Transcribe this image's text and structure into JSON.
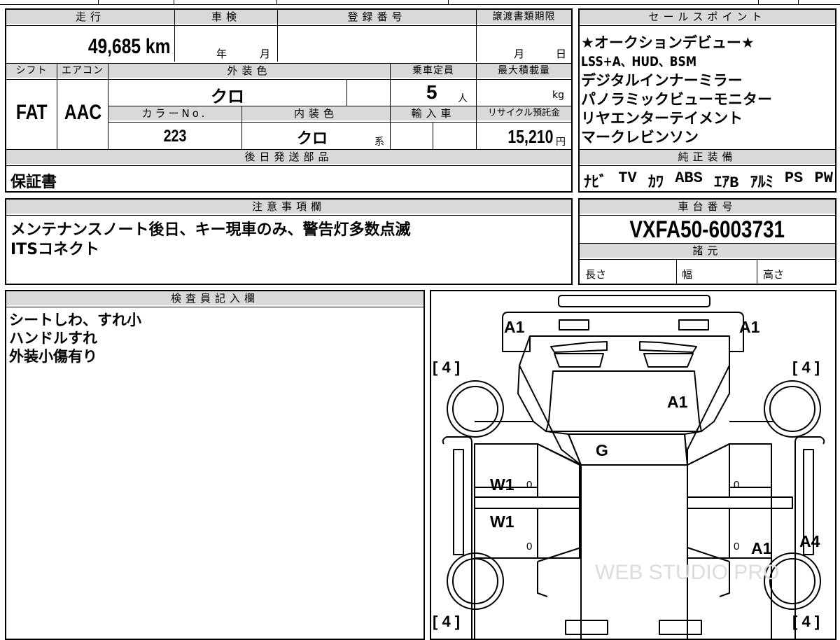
{
  "headers": {
    "mileage": "走行",
    "inspection": "車検",
    "registration": "登録番号",
    "transfer_deadline": "譲渡書類期限",
    "sales_points": "セールスポイント",
    "shift": "シフト",
    "aircon": "エアコン",
    "exterior_color": "外装色",
    "capacity": "乗車定員",
    "max_load": "最大積載量",
    "color_no": "カラーNo.",
    "interior_color": "内装色",
    "imported": "輸入車",
    "recycle": "リサイクル預託金",
    "later_parts": "後日発送部品",
    "genuine_equipment": "純正装備",
    "notes": "注意事項欄",
    "chassis_no": "車台番号",
    "specs": "諸元",
    "inspector": "検査員記入欄"
  },
  "vehicle": {
    "mileage_value": "49,685 km",
    "inspection_year_unit": "年",
    "inspection_month_unit": "月",
    "transfer_month_unit": "月",
    "transfer_day_unit": "日",
    "shift": "FAT",
    "aircon": "AAC",
    "exterior_color": "クロ",
    "capacity_value": "5",
    "capacity_unit": "人",
    "max_load_unit": "kg",
    "color_no": "223",
    "interior_color": "クロ",
    "interior_suffix": "系",
    "recycle_value": "15,210",
    "recycle_unit": "円",
    "chassis_no": "VXFA50-6003731"
  },
  "sales_points": [
    "★オークションデビュー★",
    "LSS+A、HUD、BSM",
    "デジタルインナーミラー",
    "パノラミックビューモニター",
    "リヤエンターテイメント",
    "マークレビンソン"
  ],
  "later_parts": "保証書",
  "equipment": [
    "ﾅﾋﾞ",
    "TV",
    "ｶﾜ",
    "ABS",
    "ｴｱB",
    "ｱﾙﾐ",
    "PS",
    "PW"
  ],
  "notes": [
    "メンテナンスノート後日、キー現車のみ、警告灯多数点滅",
    "ITSコネクト"
  ],
  "specs": {
    "length": "長さ",
    "width": "幅",
    "height": "高さ"
  },
  "inspector_notes": [
    "シートしわ、すれ小",
    "ハンドルすれ",
    "外装小傷有り"
  ],
  "diagram": {
    "tire_front_left": "[ 4 ]",
    "tire_front_right": "[ 4 ]",
    "tire_rear_left": "[ 4 ]",
    "tire_rear_right": "[ 4 ]",
    "marks": {
      "front_left": "A1",
      "front_right": "A1",
      "hood": "A1",
      "windshield": "G",
      "left_front_door": "W1",
      "left_rear_door": "W1",
      "right_rear_door": "A1",
      "right_rear_fender": "A4"
    },
    "door_zeros": [
      "0",
      "0",
      "0",
      "0"
    ],
    "watermark": "WEB STUDIO PRO"
  }
}
